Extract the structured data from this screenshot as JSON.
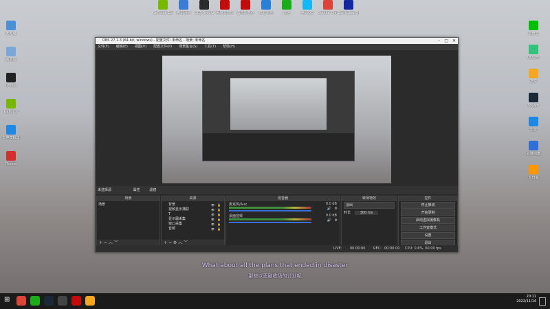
{
  "desktop": {
    "top_icons": [
      {
        "label": "GeForce Experience",
        "color": "#76b900"
      },
      {
        "label": "腾讯网易",
        "color": "#3a7bd5"
      },
      {
        "label": "OBS Studio",
        "color": "#2b2b2b"
      },
      {
        "label": "网易云音乐",
        "color": "#c20c0c"
      },
      {
        "label": "云音乐中心",
        "color": "#c20c0c"
      },
      {
        "label": "微软账号",
        "color": "#2a7fd6"
      },
      {
        "label": "微信",
        "color": "#1aad19"
      },
      {
        "label": "腾讯QQ",
        "color": "#12b7f5"
      },
      {
        "label": "Google Chrome",
        "color": "#db4437"
      },
      {
        "label": "Samsung 音乐",
        "color": "#1428a0"
      }
    ],
    "left_icons": [
      {
        "label": "此电脑",
        "color": "#4a90d9"
      },
      {
        "label": "回收站",
        "color": "#7aa7d8"
      },
      {
        "label": "Unreal",
        "color": "#222222"
      },
      {
        "label": "GeForce",
        "color": "#76b900"
      },
      {
        "label": "雷电模拟器",
        "color": "#1e88e5"
      },
      {
        "label": "Fitness",
        "color": "#d32f2f"
      }
    ],
    "right_icons": [
      {
        "label": "爱奇艺",
        "color": "#00be06"
      },
      {
        "label": "QQ音乐",
        "color": "#31c27c"
      },
      {
        "label": "文件",
        "color": "#f5a623"
      },
      {
        "label": "Steam",
        "color": "#1b2838"
      },
      {
        "label": "迅雷",
        "color": "#1e88e5"
      },
      {
        "label": "百度网盘",
        "color": "#2f6fd6"
      },
      {
        "label": "向日葵",
        "color": "#ff9800"
      }
    ]
  },
  "obs": {
    "title": "OBS 27.1.3 (64-bit, windows) - 配置文件: 未命名 - 场景: 未命名",
    "menu": [
      "文件(F)",
      "编辑(E)",
      "视图(V)",
      "配置文件(P)",
      "场景集合(S)",
      "工具(T)",
      "帮助(H)"
    ],
    "scene_bar_label": "未选择源",
    "scene_bar_buttons": [
      "属性",
      "滤镜"
    ],
    "docks": {
      "scenes": {
        "header": "场景",
        "items": [
          "场景"
        ]
      },
      "sources": {
        "header": "来源",
        "items": [
          "背景",
          "视频显示捕获",
          "T",
          "显示器采集",
          "窗口采集",
          "音频"
        ]
      },
      "mixer": {
        "header": "混音器",
        "channels": [
          {
            "name": "麦克风/Aux",
            "db": "0.0 dB"
          },
          {
            "name": "桌面音频",
            "db": "0.0 dB"
          }
        ]
      },
      "transitions": {
        "header": "转场特效",
        "type": "淡出",
        "duration_label": "时长",
        "duration_value": "300 ms"
      },
      "controls": {
        "header": "控件",
        "buttons": [
          "停止推流",
          "开始录制",
          "启动虚拟摄像机",
          "工作室模式",
          "设置",
          "退出"
        ]
      }
    },
    "status": {
      "live_label": "LIVE:",
      "live_time": "00:00:00",
      "rec_label": "REC:",
      "rec_time": "00:00:00",
      "cpu": "CPU: 0.6%, 60.00 fps"
    }
  },
  "subtitles": {
    "english": "What about all the plans that ended in disaster",
    "chinese": "那些以悲剧收场的计划呢"
  },
  "taskbar": {
    "apps": [
      {
        "name": "chrome",
        "color": "#db4437"
      },
      {
        "name": "wechat",
        "color": "#1aad19"
      },
      {
        "name": "steam",
        "color": "#1b2838"
      },
      {
        "name": "obs",
        "color": "#444444"
      },
      {
        "name": "netease-music",
        "color": "#c20c0c"
      },
      {
        "name": "file-explorer",
        "color": "#f5a623"
      }
    ],
    "time": "20:11",
    "date": "2022/11/14"
  }
}
